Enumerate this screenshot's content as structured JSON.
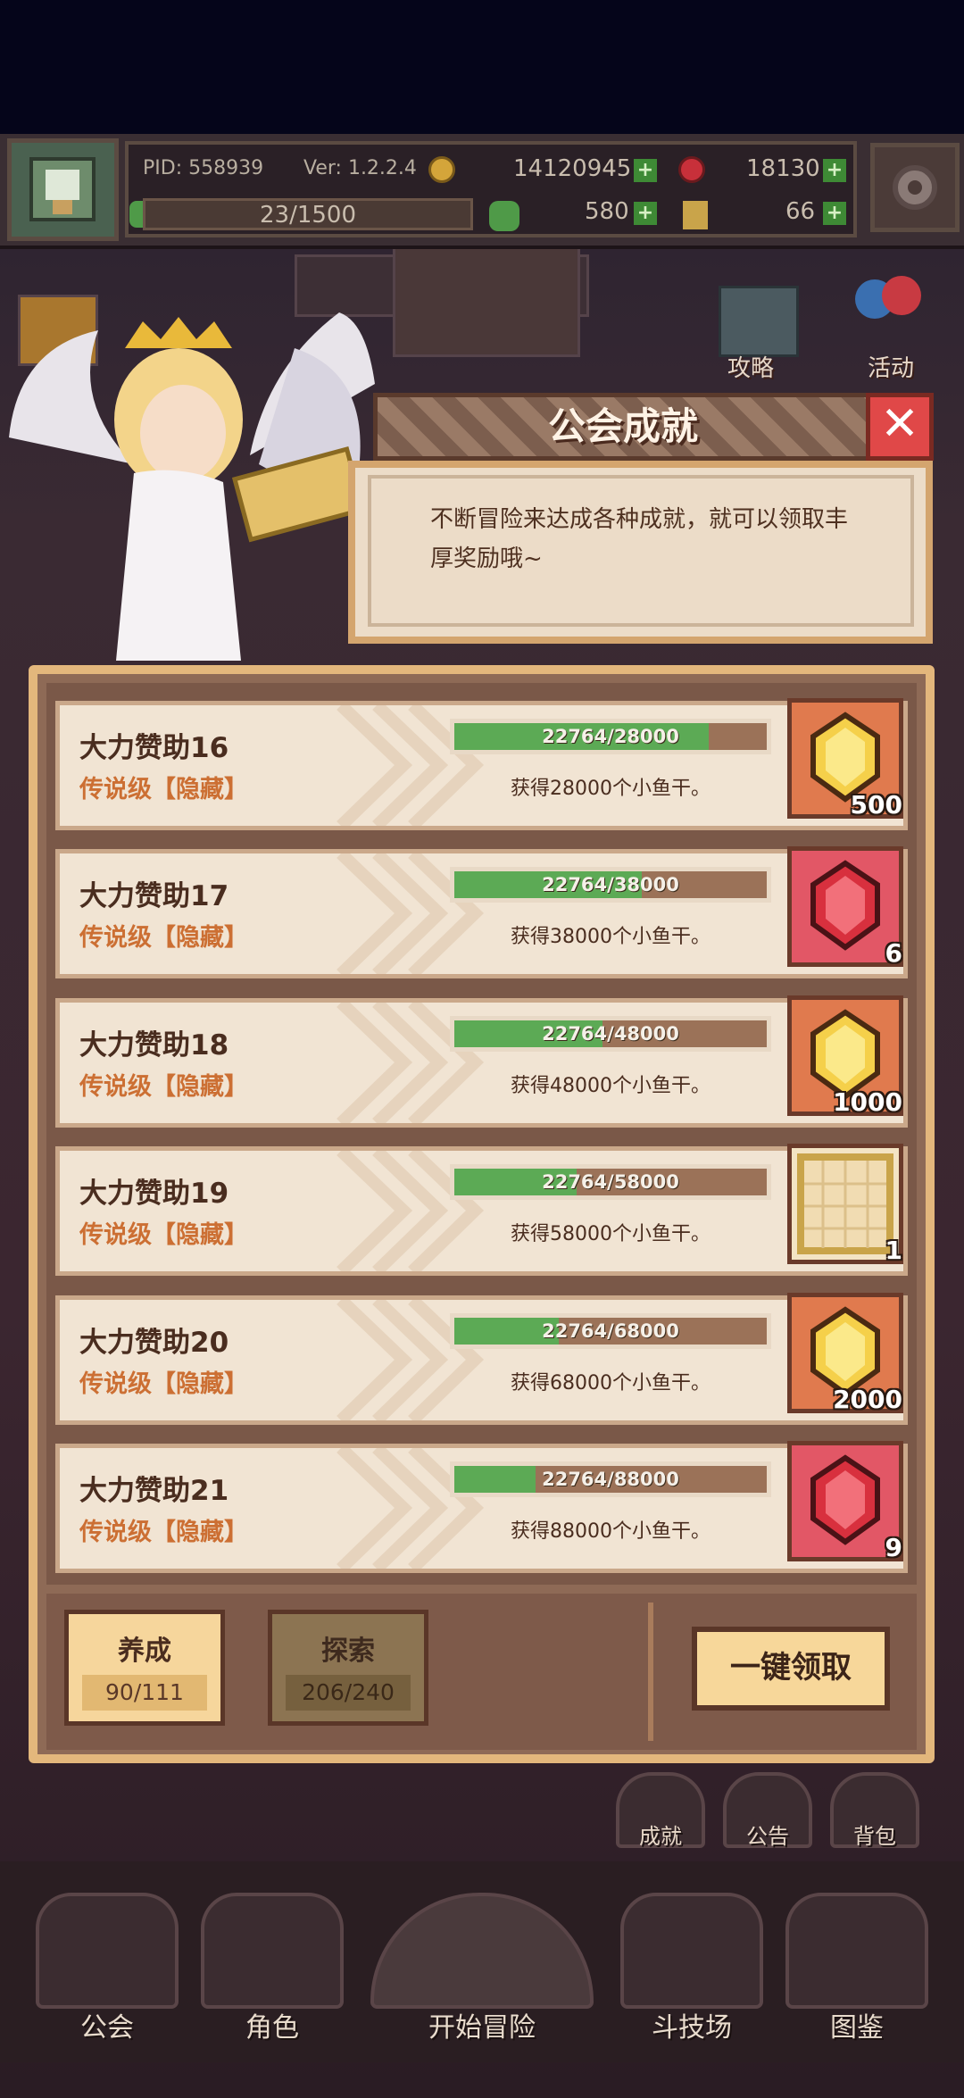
{
  "topbar": {
    "pid": "PID: 558939",
    "version": "Ver: 1.2.2.4",
    "gold": "14120945",
    "gems": "18130",
    "xp": "23/1500",
    "clover": "580",
    "key": "66"
  },
  "side_buttons": {
    "strategy": "攻略",
    "events": "活动"
  },
  "dialog": {
    "title": "公会成就",
    "close_symbol": "✕",
    "description": "不断冒险来达成各种成就，就可以领取丰厚奖励哦~"
  },
  "achievements": [
    {
      "name": "大力赞助16",
      "tier": "传说级【隐藏】",
      "progress_text": "22764/28000",
      "progress": 0.813,
      "reward_text": "获得28000个小鱼干。",
      "reward_icon": "gold-crystal-icon",
      "reward_count": "500"
    },
    {
      "name": "大力赞助17",
      "tier": "传说级【隐藏】",
      "progress_text": "22764/38000",
      "progress": 0.599,
      "reward_text": "获得38000个小鱼干。",
      "reward_icon": "red-gem-icon",
      "reward_count": "6"
    },
    {
      "name": "大力赞助18",
      "tier": "传说级【隐藏】",
      "progress_text": "22764/48000",
      "progress": 0.474,
      "reward_text": "获得48000个小鱼干。",
      "reward_icon": "gold-crystal-icon",
      "reward_count": "1000"
    },
    {
      "name": "大力赞助19",
      "tier": "传说级【隐藏】",
      "progress_text": "22764/58000",
      "progress": 0.392,
      "reward_text": "获得58000个小鱼干。",
      "reward_icon": "floor-tile-icon",
      "reward_count": "1"
    },
    {
      "name": "大力赞助20",
      "tier": "传说级【隐藏】",
      "progress_text": "22764/68000",
      "progress": 0.335,
      "reward_text": "获得68000个小鱼干。",
      "reward_icon": "gold-crystal-icon",
      "reward_count": "2000"
    },
    {
      "name": "大力赞助21",
      "tier": "传说级【隐藏】",
      "progress_text": "22764/88000",
      "progress": 0.259,
      "reward_text": "获得88000个小鱼干。",
      "reward_icon": "red-gem-icon",
      "reward_count": "9"
    }
  ],
  "tabs": [
    {
      "label": "养成",
      "count": "90/111"
    },
    {
      "label": "探索",
      "count": "206/240"
    }
  ],
  "claim_all": "一键领取",
  "mini_buttons": {
    "achievements": "成就",
    "notice": "公告",
    "bag": "背包"
  },
  "nav": [
    "公会",
    "角色",
    "开始冒险",
    "斗技场",
    "图鉴"
  ],
  "colors": {
    "progress_fill": "#5caa55",
    "tier_text": "#cc6f33",
    "close_red": "#e04848",
    "accent_gold": "#e3b77c"
  }
}
